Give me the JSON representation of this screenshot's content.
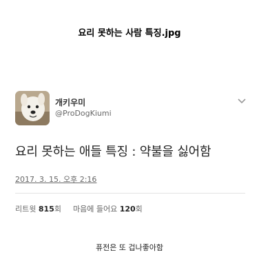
{
  "post": {
    "title": "요리 못하는 사람 특징.jpg",
    "caption": "퓨전은 또 겁나좋아함"
  },
  "tweet": {
    "display_name": "개키우미",
    "handle": "@ProDogKiumi",
    "text": "요리 못하는 애들 특징 : 약불을 싫어함",
    "timestamp": "2017. 3. 15. 오후 2:16",
    "retweets_label": "리트윗",
    "retweets_count": "815",
    "retweets_unit": "회",
    "likes_label": "마음에 들어요",
    "likes_count": "120",
    "likes_unit": "회",
    "menu_icon": "chevron-down-icon",
    "avatar_icon": "dog-photo"
  }
}
